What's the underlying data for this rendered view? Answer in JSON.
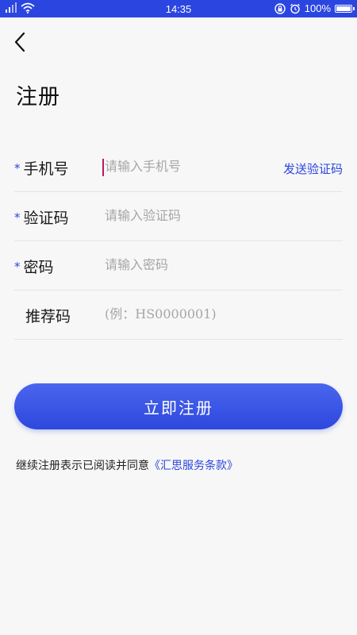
{
  "status_bar": {
    "time": "14:35",
    "battery_text": "100%",
    "battery_level": 1.0,
    "icons": [
      "signal-icon",
      "wifi-icon",
      "rotation-lock-icon",
      "alarm-icon",
      "battery-icon"
    ]
  },
  "header": {
    "back_icon": "chevron-left-icon",
    "title": "注册"
  },
  "form": {
    "phone": {
      "required_mark": "*",
      "label": "手机号",
      "placeholder": "请输入手机号",
      "value": "",
      "action_label": "发送验证码"
    },
    "code": {
      "required_mark": "*",
      "label": "验证码",
      "placeholder": "请输入验证码",
      "value": ""
    },
    "password": {
      "required_mark": "*",
      "label": "密码",
      "placeholder": "请输入密码",
      "value": ""
    },
    "referral": {
      "label": "推荐码",
      "placeholder": "(例：HS0000001)",
      "value": ""
    }
  },
  "register_button": {
    "label": "立即注册"
  },
  "agreement": {
    "prefix": "继续注册表示已阅读并同意",
    "link_text": "《汇思服务条款》"
  },
  "colors": {
    "accent": "#2b46e0",
    "background": "#f7f7f7",
    "cursor": "#c2185b"
  }
}
